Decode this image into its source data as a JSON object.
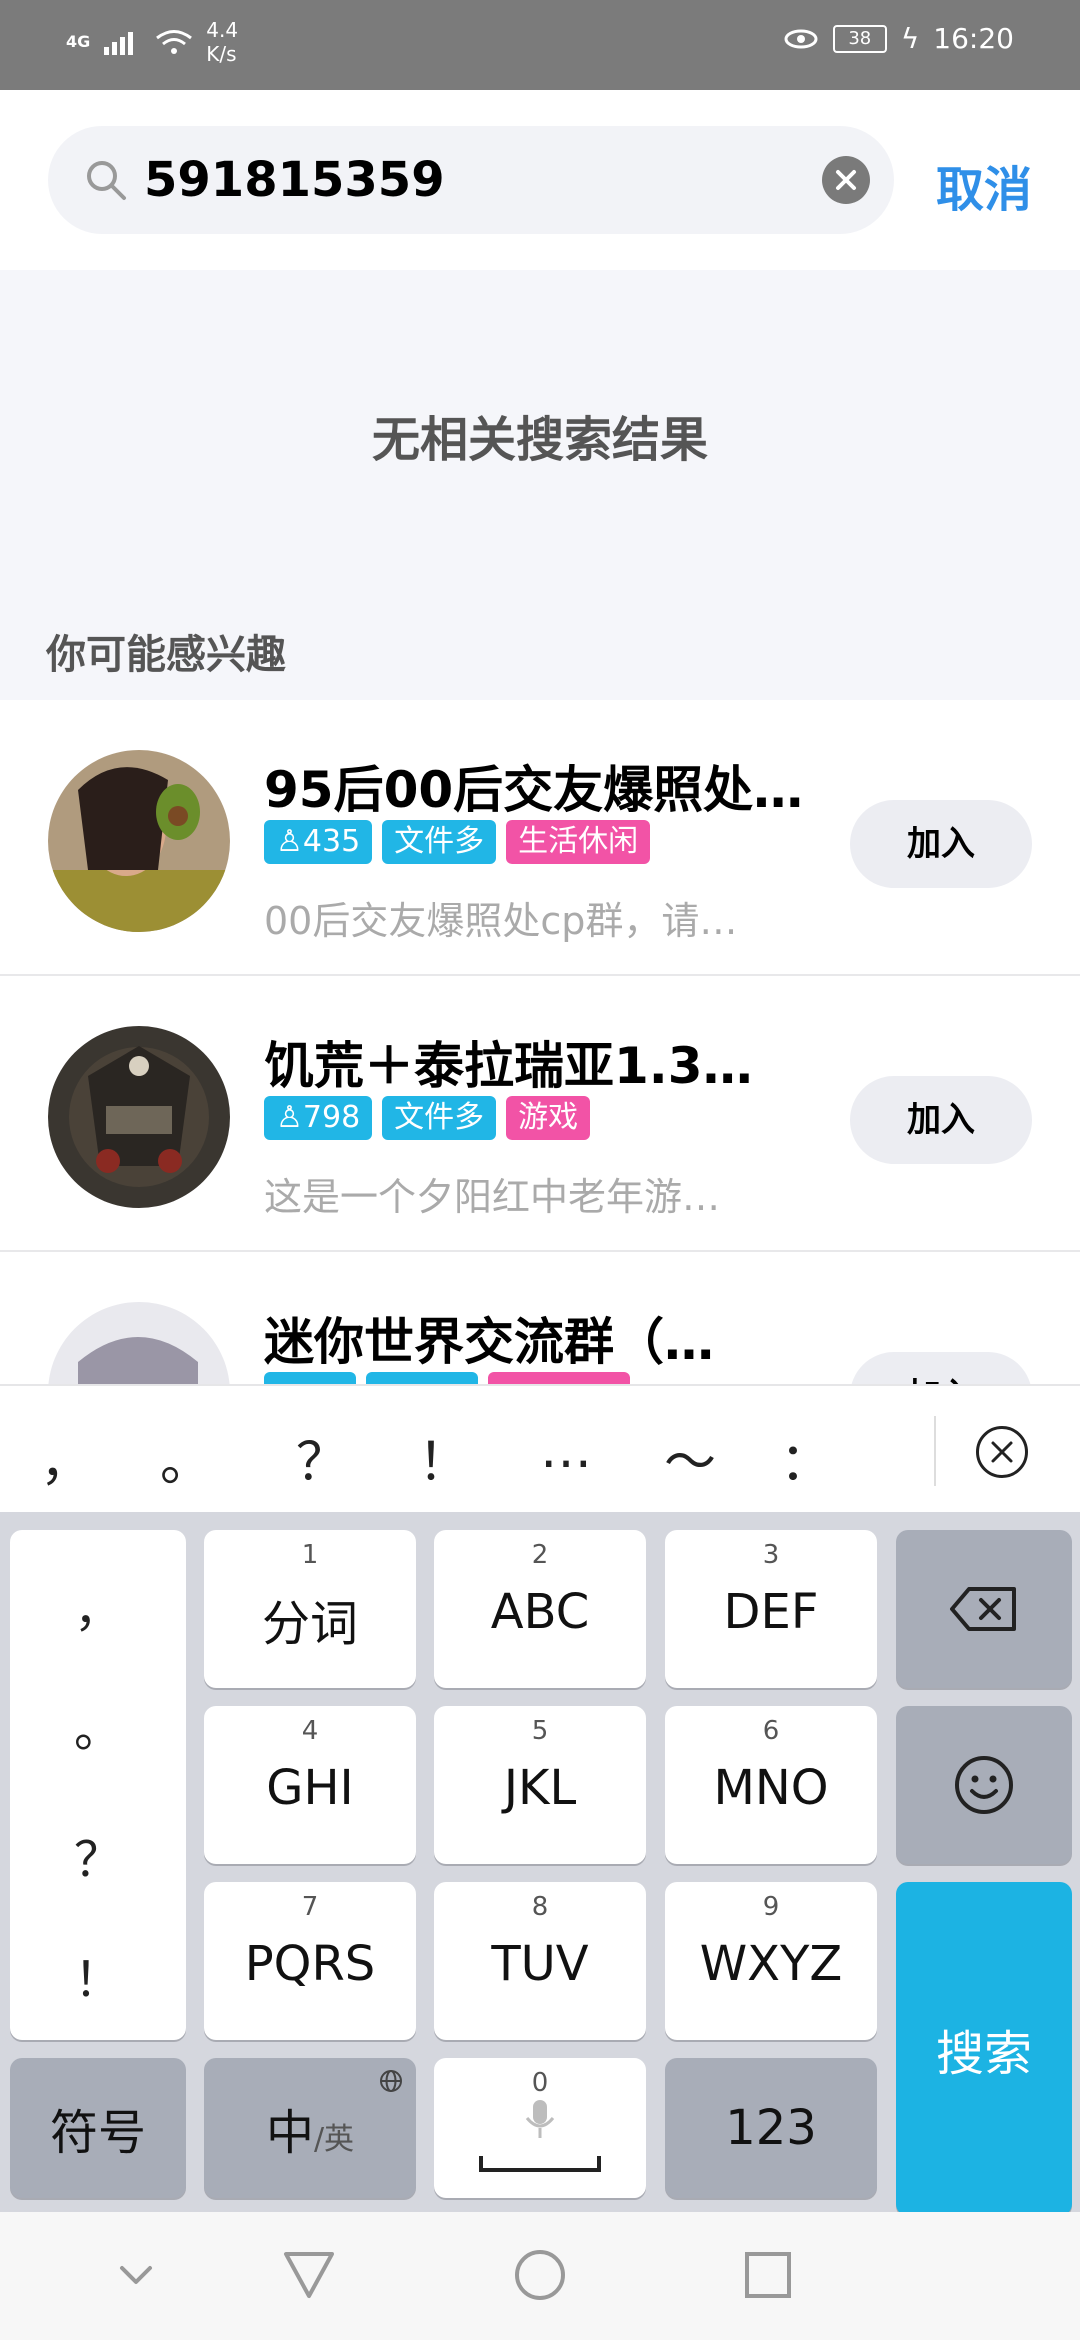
{
  "status_bar": {
    "network": "4G",
    "speed_value": "4.4",
    "speed_unit": "K/s",
    "battery": "38",
    "time": "16:20"
  },
  "search": {
    "query": "591815359",
    "cancel_label": "取消",
    "icon": "search-icon",
    "clear_icon": "clear-icon"
  },
  "results": {
    "empty_message": "无相关搜索结果",
    "section_title": "你可能感兴趣"
  },
  "groups": [
    {
      "name": "95后00后交友爆照处…",
      "members": "435",
      "tags": [
        "文件多",
        "生活休闲"
      ],
      "desc": "00后交友爆照处cp群，请…",
      "join_label": "加入"
    },
    {
      "name": "饥荒＋泰拉瑞亚1.3…",
      "members": "798",
      "tags": [
        "文件多",
        "游戏"
      ],
      "desc": "这是一个夕阳红中老年游…",
      "join_label": "加入"
    },
    {
      "name": "迷你世界交流群（…",
      "members": "",
      "tags": [
        "",
        ""
      ],
      "desc": "",
      "join_label": "加入"
    }
  ],
  "punctuation_bar": {
    "items": [
      "，",
      "。",
      "？",
      "！",
      "…",
      "～",
      "："
    ]
  },
  "keyboard": {
    "punct_col": [
      "，",
      "。",
      "？",
      "！"
    ],
    "keys": [
      {
        "num": "1",
        "label": "分词"
      },
      {
        "num": "2",
        "label": "ABC"
      },
      {
        "num": "3",
        "label": "DEF"
      },
      {
        "num": "4",
        "label": "GHI"
      },
      {
        "num": "5",
        "label": "JKL"
      },
      {
        "num": "6",
        "label": "MNO"
      },
      {
        "num": "7",
        "label": "PQRS"
      },
      {
        "num": "8",
        "label": "TUV"
      },
      {
        "num": "9",
        "label": "WXYZ"
      }
    ],
    "symbol_label": "符号",
    "lang_main": "中",
    "lang_sub": "/英",
    "space_num": "0",
    "num_label": "123",
    "search_label": "搜索"
  },
  "colors": {
    "accent": "#2f8fe8",
    "tag_blue": "#21b6e6",
    "tag_pink": "#f253a6",
    "search_key": "#1cb3e3"
  }
}
